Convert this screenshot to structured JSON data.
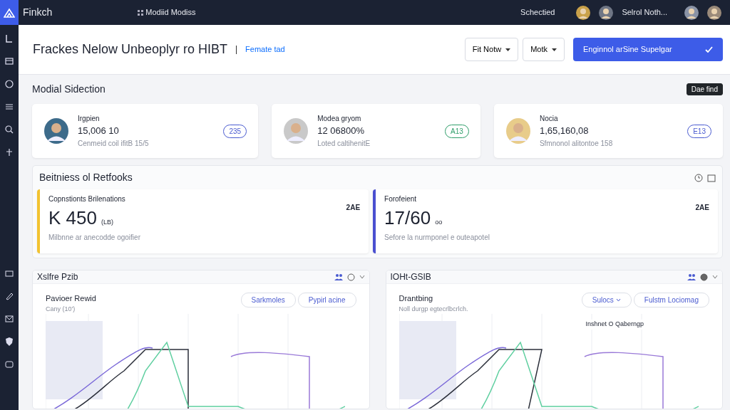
{
  "topbar": {
    "app_name": "Finkch",
    "center_label": "Modiid Modiss",
    "status": "Schectied",
    "user_name": "Selrol Noth..."
  },
  "header": {
    "title": "Frackes Nelow Unbeoplyr ro HIBT",
    "link": "Femate tad",
    "dropdowns": [
      "Fit Notw",
      "Motk"
    ],
    "primary_button": "Enginnol arSine Supelgar"
  },
  "summary": {
    "title": "Modial Sidection",
    "button": "Dae find",
    "cards": [
      {
        "name": "Irgpien",
        "value": "15,006 10",
        "caption": "Cenmeid coil ifitB 15/5",
        "badge": "235",
        "color": "#4a5bd0"
      },
      {
        "name": "Modea gryom",
        "value": "12 06800%",
        "caption": "Loted caltihenitE",
        "badge": "A13",
        "color": "#2f9e6a"
      },
      {
        "name": "Nocia",
        "value": "1,65,160,08",
        "caption": "Sfmnonol alitontoe 158",
        "badge": "E13",
        "color": "#4a5bd0"
      }
    ]
  },
  "metrics": {
    "title": "Beitniess ol Retfooks",
    "items": [
      {
        "label": "Copnstionts Brilenations",
        "value": "K 450",
        "unit": "(LB)",
        "caption": "Milbnne ar anecodde ogoifier",
        "tag": "2AE",
        "color": "#f2c230"
      },
      {
        "label": "Forofeient",
        "value": "17/60",
        "unit": "oo",
        "caption": "Sefore la nurmponel e outeapotel",
        "tag": "2AE",
        "color": "#4a4fd0"
      }
    ]
  },
  "panels": [
    {
      "title": "Xslfre Pzib",
      "heading": "Pavioer Rewid",
      "subtitle": "Cany (10')",
      "buttons": [
        {
          "label": "Sarkmoles",
          "dropdown": false
        },
        {
          "label": "Pypirl acine",
          "dropdown": false
        }
      ]
    },
    {
      "title": "IOHt-GSIB",
      "heading": "Drantbing",
      "subtitle": "Noll durgp egtecrlbcrlch.",
      "annotation": "Inshnet O Qaberngp",
      "buttons": [
        {
          "label": "Sulocs",
          "dropdown": true
        },
        {
          "label": "Fulstm Lociomag",
          "dropdown": false
        }
      ]
    }
  ]
}
